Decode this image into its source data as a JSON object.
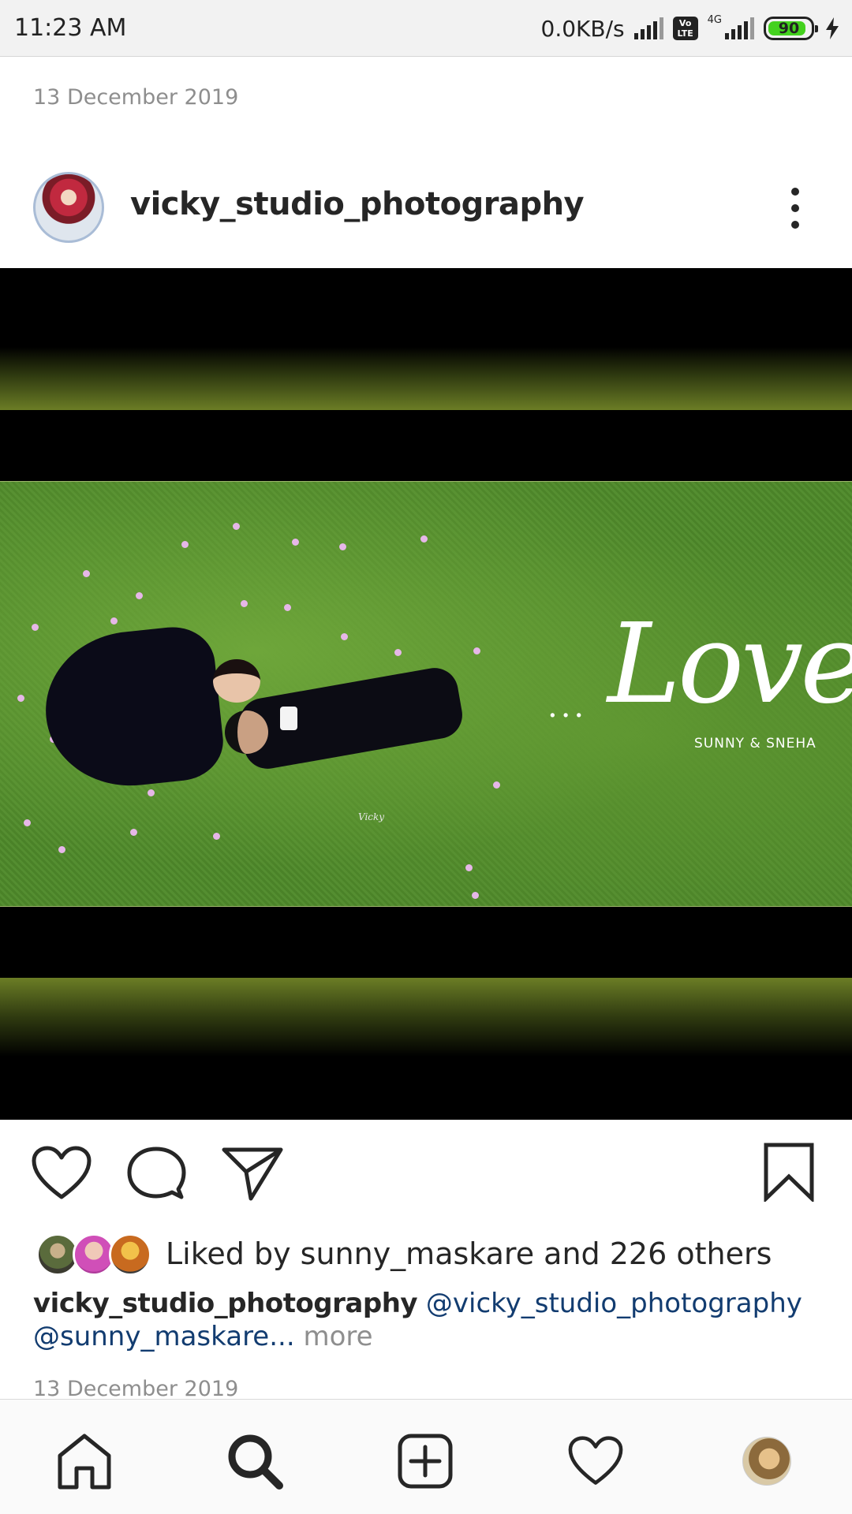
{
  "status_bar": {
    "time": "11:23 AM",
    "net_speed": "0.0KB/s",
    "volte": "Vo LTE",
    "network_type": "4G",
    "battery": "90",
    "battery_color": "#44d11e"
  },
  "previous_post": {
    "date": "13 December 2019"
  },
  "post": {
    "username": "vicky_studio_photography",
    "image_text": {
      "dots": "...",
      "title": "Love",
      "names": "SUNNY & SNEHA",
      "signature": "Vicky"
    },
    "liked_by": "Liked by sunny_maskare and 226 others",
    "caption": {
      "username": "vicky_studio_photography",
      "mention_1": "@vicky_studio_photography",
      "mention_2": "@sunny_maskare",
      "ellipsis": "...",
      "more": "more"
    },
    "date": "13 December 2019"
  },
  "icons": {
    "actions": [
      "heart-icon",
      "comment-icon",
      "share-icon",
      "bookmark-icon"
    ],
    "nav": [
      "home-icon",
      "search-icon",
      "add-post-icon",
      "activity-heart-icon",
      "profile-avatar"
    ]
  },
  "colors": {
    "link": "#123c70",
    "muted": "#8e8e8e",
    "text": "#262626"
  }
}
